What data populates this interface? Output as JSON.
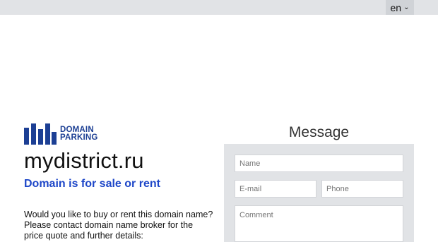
{
  "language": {
    "selected": "en",
    "icon": "chevron-down-icon"
  },
  "logo": {
    "line1": "DOMAIN",
    "line2": "PARKING"
  },
  "domain": "mydistrict.ru",
  "tagline": "Domain is for sale or rent",
  "description": "Would you like to buy or rent this domain name? Please contact domain name broker for the price quote and further details:",
  "form": {
    "title": "Message",
    "name_placeholder": "Name",
    "email_placeholder": "E-mail",
    "phone_placeholder": "Phone",
    "comment_placeholder": "Comment"
  },
  "colors": {
    "brand": "#1c3f94",
    "accent": "#1e47c8",
    "panel": "#e1e3e6"
  }
}
